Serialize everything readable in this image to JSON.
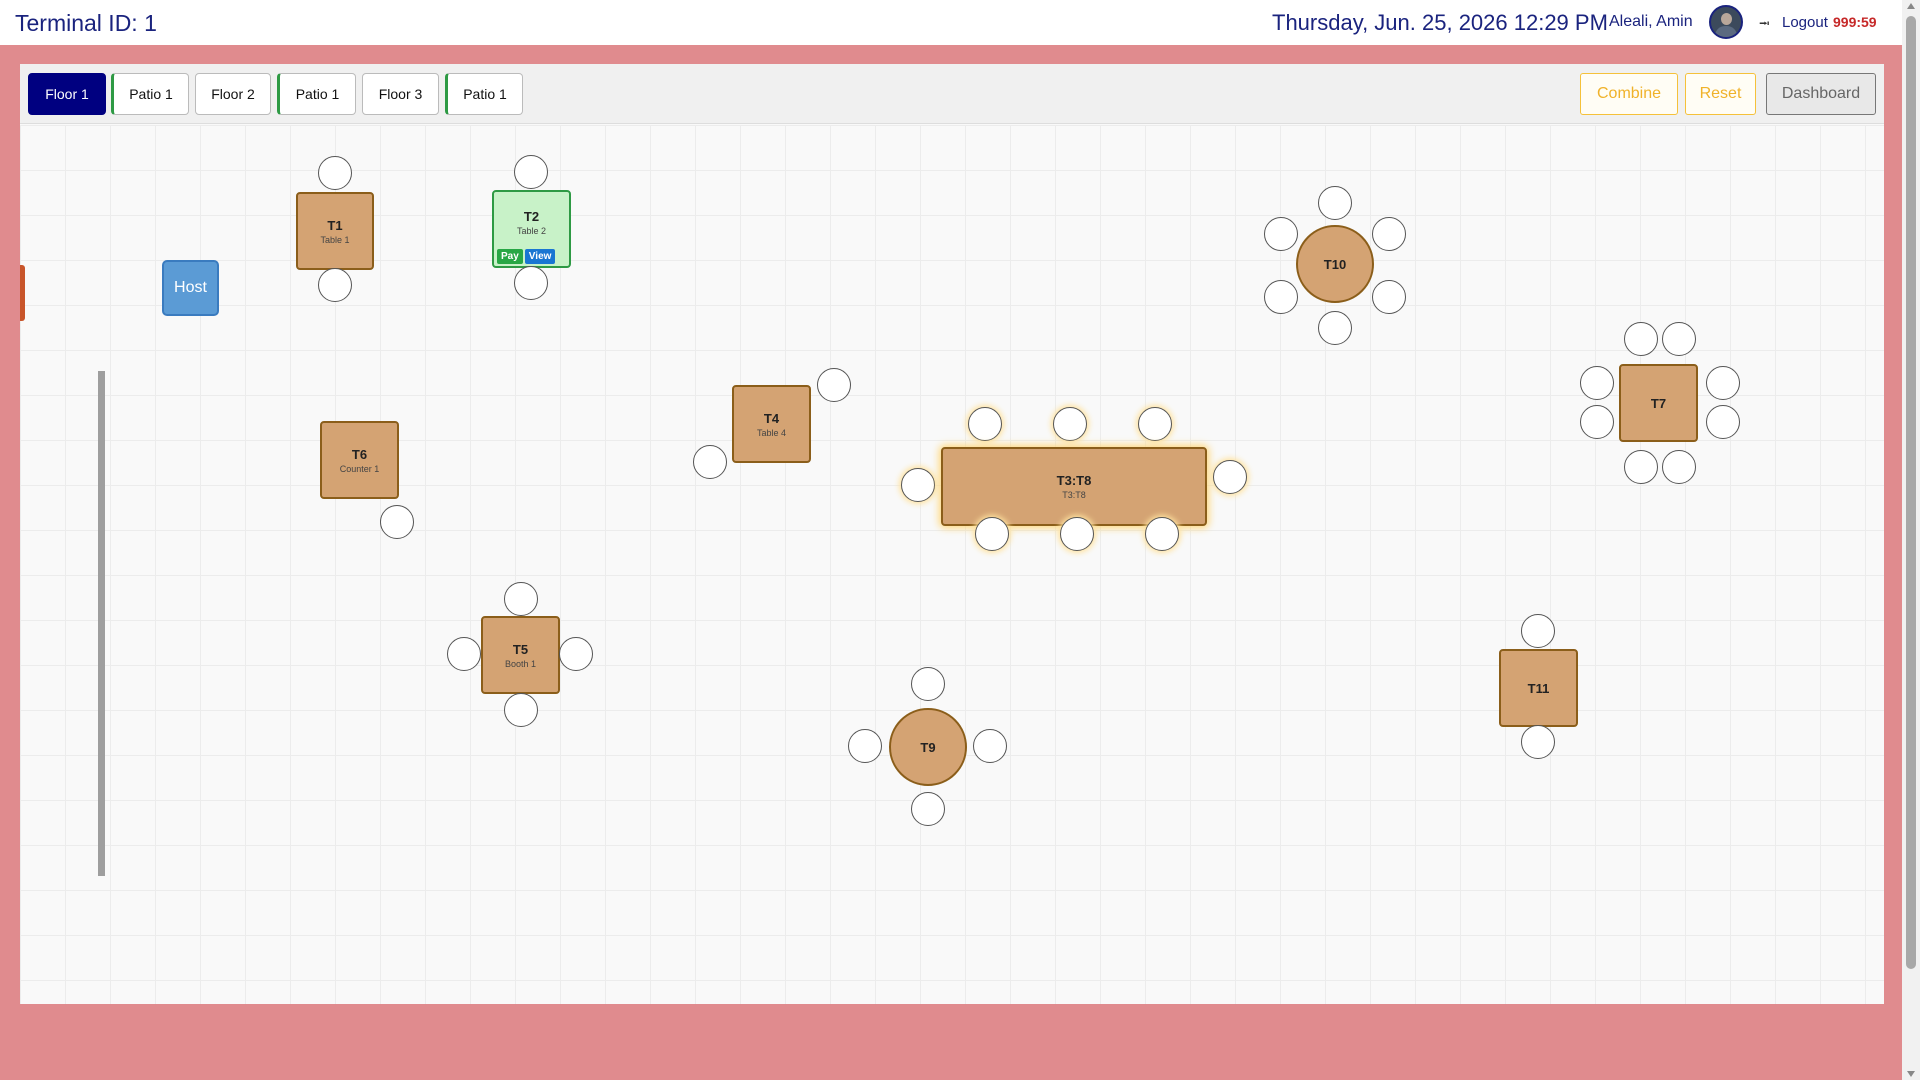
{
  "header": {
    "terminal": "Terminal ID: 1",
    "datetime": "Thursday, Jun. 25, 2026 12:29 PM",
    "user": "Aleali, Amin",
    "logout": "Logout",
    "timer": "999:59"
  },
  "tabs": [
    {
      "label": "Floor 1",
      "active": true
    },
    {
      "label": "Patio 1"
    },
    {
      "label": "Floor 2"
    },
    {
      "label": "Patio 1"
    },
    {
      "label": "Floor 3"
    },
    {
      "label": "Patio 1"
    }
  ],
  "actions": {
    "combine": "Combine",
    "reset": "Reset",
    "dashboard": "Dashboard"
  },
  "floor": {
    "host": "Host",
    "tables": [
      {
        "code": "T1",
        "name": "Table 1"
      },
      {
        "code": "T2",
        "name": "Table 2",
        "pay": "Pay",
        "view": "View"
      },
      {
        "code": "T10",
        "name": ""
      },
      {
        "code": "T4",
        "name": "Table 4"
      },
      {
        "code": "T3:T8",
        "name": "T3:T8"
      },
      {
        "code": "T7",
        "name": ""
      },
      {
        "code": "T6",
        "name": "Counter 1"
      },
      {
        "code": "T5",
        "name": "Booth 1"
      },
      {
        "code": "T9",
        "name": ""
      },
      {
        "code": "T11",
        "name": ""
      }
    ]
  },
  "colors": {
    "active_tab": "#000080",
    "table": "#d4a373",
    "occupied_table": "#c8f2c8",
    "background": "#e08b8e"
  }
}
